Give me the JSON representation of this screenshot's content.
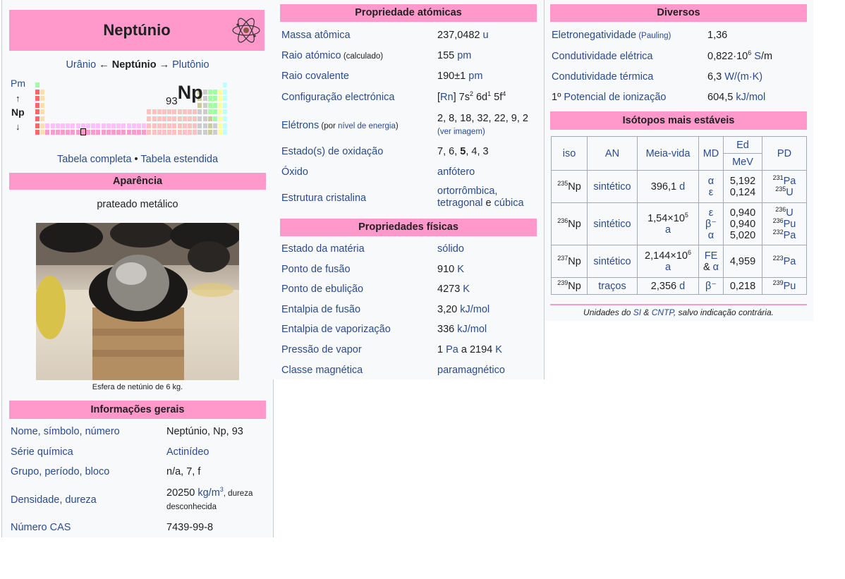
{
  "element": {
    "name": "Neptúnio",
    "nav_prev": "Urânio",
    "nav_current": "Neptúnio",
    "nav_next": "Plutônio",
    "arrow_left": "←",
    "arrow_right": "→",
    "pt_above": "Pm",
    "pt_current": "Np",
    "pt_below": "↓",
    "pt_up": "↑",
    "atomic_number": "93",
    "symbol": "Np",
    "table_full": "Tabela completa",
    "table_sep": " • ",
    "table_extended": "Tabela estendida"
  },
  "appearance": {
    "header": "Aparência",
    "text": "prateado metálico",
    "caption": "Esfera de netúnio de 6 kg."
  },
  "general": {
    "header": "Informações gerais",
    "rows": [
      {
        "k": "Nome, símbolo, número",
        "v": "Neptúnio, Np, 93"
      },
      {
        "k": "Série química",
        "v": "Actinídeo"
      },
      {
        "k": "Grupo, período, bloco",
        "v": "n/a, 7, f"
      },
      {
        "k": "Densidade, dureza",
        "v1": "20250 ",
        "v_link": "kg/m",
        "v_sup": "3",
        "v_small": ", dureza desconhecida"
      },
      {
        "k": "Número CAS",
        "v": "7439-99-8"
      }
    ]
  },
  "atomic": {
    "header": "Propriedade atómicas",
    "rows": [
      {
        "k": "Massa atômica",
        "v": "237,0482 ",
        "u": "u"
      },
      {
        "k": "Raio atómico",
        "k_small": " (calculado)",
        "v": "155 ",
        "u": "pm"
      },
      {
        "k": "Raio covalente",
        "v": "190±1 ",
        "u": "pm"
      },
      {
        "k": "Configuração electrónica",
        "v": "[Rn] 7s2 6d1 5f4"
      },
      {
        "k": "Elétrons",
        "k_small": " (por ",
        "k_small_link": "nível de energia",
        "k_small_end": ")",
        "v": "2, 8, 18, 32, 22, 9, 2",
        "v2": "(ver imagem)"
      },
      {
        "k": "Estado(s) de oxidação",
        "v": "7, 6, 5, 4, 3"
      },
      {
        "k": "Óxido",
        "v": "anfótero"
      },
      {
        "k": "Estrutura cristalina",
        "v": "ortorrômbica,",
        "v2a": "tetragonal",
        "v2b": " e ",
        "v2c": "cúbica"
      }
    ]
  },
  "physical": {
    "header": "Propriedades físicas",
    "rows": [
      {
        "k": "Estado da matéria",
        "v": "sólido"
      },
      {
        "k": "Ponto de fusão",
        "v": "910 ",
        "u": "K"
      },
      {
        "k": "Ponto de ebulição",
        "v": "4273 ",
        "u": "K"
      },
      {
        "k": "Entalpia de fusão",
        "v": "3,20 ",
        "u": "kJ/mol"
      },
      {
        "k": "Entalpia de vaporização",
        "v": "336 ",
        "u": "kJ/mol"
      },
      {
        "k": "Pressão de vapor",
        "v": "1 ",
        "u": "Pa",
        "v_rest": " a 2194 ",
        "u2": "K"
      },
      {
        "k": "Classe magnética",
        "v": "paramagnético"
      }
    ]
  },
  "misc": {
    "header": "Diversos",
    "rows": [
      {
        "k": "Eletronegatividade",
        "k_small": " (Pauling)",
        "v": "1,36"
      },
      {
        "k": "Condutividade elétrica",
        "v": "0,822·10",
        "v_sup": "6",
        "u": " S",
        "v_end": "/m"
      },
      {
        "k": "Condutividade térmica",
        "v": "6,3 ",
        "u": "W/(m·K)"
      },
      {
        "k_pre": "1º ",
        "k": "Potencial de ionização",
        "v": "604,5 ",
        "u": "kJ/mol"
      }
    ]
  },
  "isotopes": {
    "header": "Isótopos mais estáveis",
    "cols": [
      "iso",
      "AN",
      "Meia-vida",
      "MD",
      "Ed",
      "MeV",
      "PD"
    ],
    "rows": [
      {
        "mass": "235",
        "sym": "Np",
        "an": "sintético",
        "hl": "396,1 ",
        "hl_unit": "d",
        "md": [
          "α",
          "ε"
        ],
        "ed": [
          "5,192",
          "0,124"
        ],
        "pd": [
          [
            "231",
            "Pa"
          ],
          [
            "235",
            "U"
          ]
        ]
      },
      {
        "mass": "236",
        "sym": "Np",
        "an": "sintético",
        "hl": "1,54×10",
        "hl_sup": "5",
        "hl_unit": "a",
        "md": [
          "ε",
          "β⁻",
          "α"
        ],
        "ed": [
          "0,940",
          "0,940",
          "5,020"
        ],
        "pd": [
          [
            "236",
            "U"
          ],
          [
            "236",
            "Pu"
          ],
          [
            "232",
            "Pa"
          ]
        ]
      },
      {
        "mass": "237",
        "sym": "Np",
        "an": "sintético",
        "hl": "2,144×10",
        "hl_sup": "6",
        "hl_unit": "a",
        "md": [
          "FE",
          "& α"
        ],
        "ed": [
          "4,959"
        ],
        "pd": [
          [
            "223",
            "Pa"
          ]
        ]
      },
      {
        "mass": "239",
        "sym": "Np",
        "an": "traços",
        "hl": "2,356 ",
        "hl_unit": "d",
        "md": [
          "β⁻"
        ],
        "ed": [
          "0,218"
        ],
        "pd": [
          [
            "239",
            "Pu"
          ]
        ]
      }
    ],
    "footer_pre": "Unidades do ",
    "footer_si": "SI",
    "footer_amp": " & ",
    "footer_cntp": "CNTP",
    "footer_post": ", salvo indicação contrária."
  },
  "colors": {
    "header_bg": "#ff99cc",
    "link": "#2a4b8d",
    "panel_bg": "#f8f9fa"
  }
}
